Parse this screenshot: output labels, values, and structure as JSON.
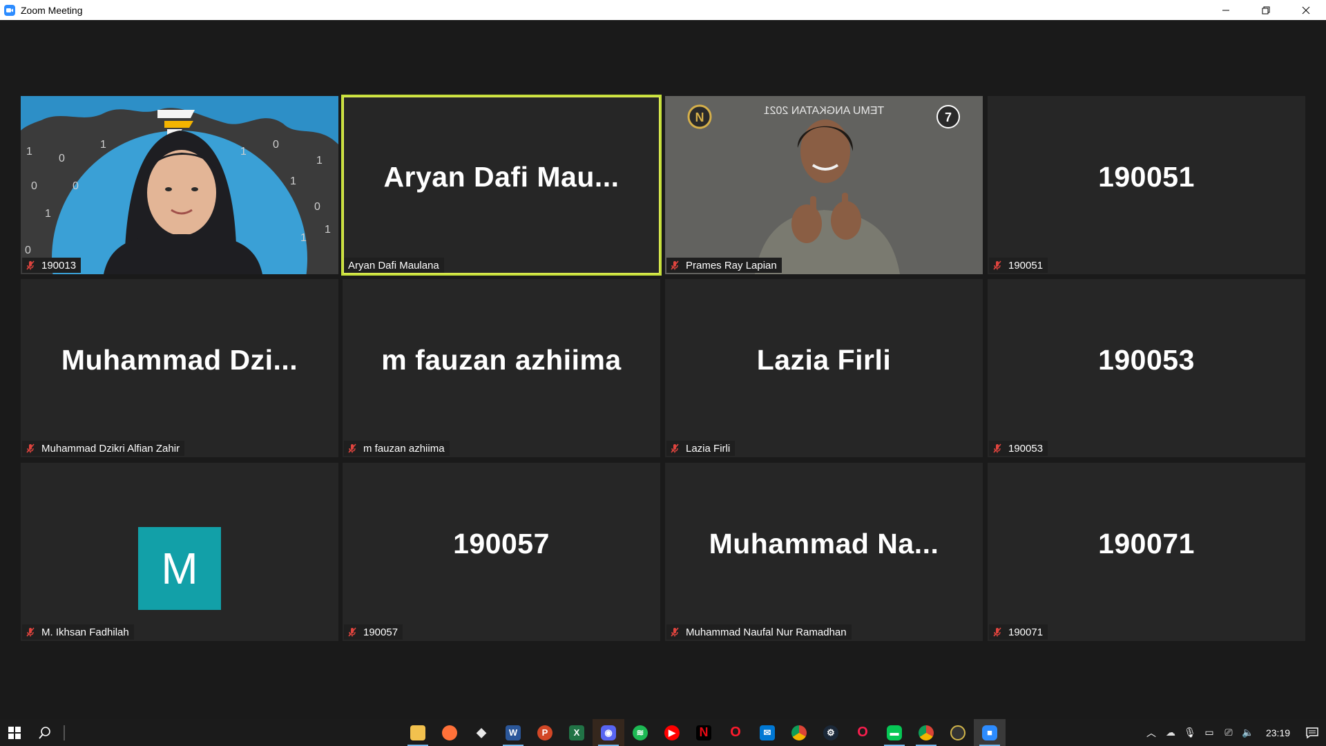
{
  "window": {
    "title": "Zoom Meeting"
  },
  "tiles": [
    {
      "big": "",
      "name": "190013"
    },
    {
      "big": "Aryan  Dafi  Mau...",
      "name": "Aryan Dafi Maulana"
    },
    {
      "big": "",
      "name": "Prames Ray Lapian"
    },
    {
      "big": "190051",
      "name": "190051"
    },
    {
      "big": "Muhammad  Dzi...",
      "name": "Muhammad Dzikri Alfian Zahir"
    },
    {
      "big": "m fauzan azhiima",
      "name": "m fauzan azhiima"
    },
    {
      "big": "Lazia Firli",
      "name": "Lazia Firli"
    },
    {
      "big": "190053",
      "name": "190053"
    },
    {
      "big": "M",
      "name": "M. Ikhsan Fadhilah"
    },
    {
      "big": "190057",
      "name": "190057"
    },
    {
      "big": "Muhammad  Na...",
      "name": "Muhammad Naufal Nur Ramadhan"
    },
    {
      "big": "190071",
      "name": "190071"
    }
  ],
  "video_overlays": {
    "tile1_digits": [
      "1",
      "0",
      "1",
      "1",
      "0",
      "1",
      "0",
      "0",
      "1",
      "1",
      "0",
      "1",
      "0",
      "1"
    ],
    "tile3_banner": "TEMU ANGKATAN 2021"
  },
  "taskbar": {
    "apps": [
      "file-explorer",
      "firefox",
      "dropbox",
      "word",
      "powerpoint",
      "excel",
      "discord",
      "spotify",
      "youtube-music",
      "netflix",
      "opera",
      "mail",
      "chrome",
      "steam",
      "opera-gx",
      "line",
      "chrome-alt",
      "app-circle",
      "zoom"
    ],
    "clock": "23:19"
  },
  "colors": {
    "accent_active": "#c7e03b",
    "avatar_bg": "#12a0a8",
    "mute": "#e0443e"
  }
}
